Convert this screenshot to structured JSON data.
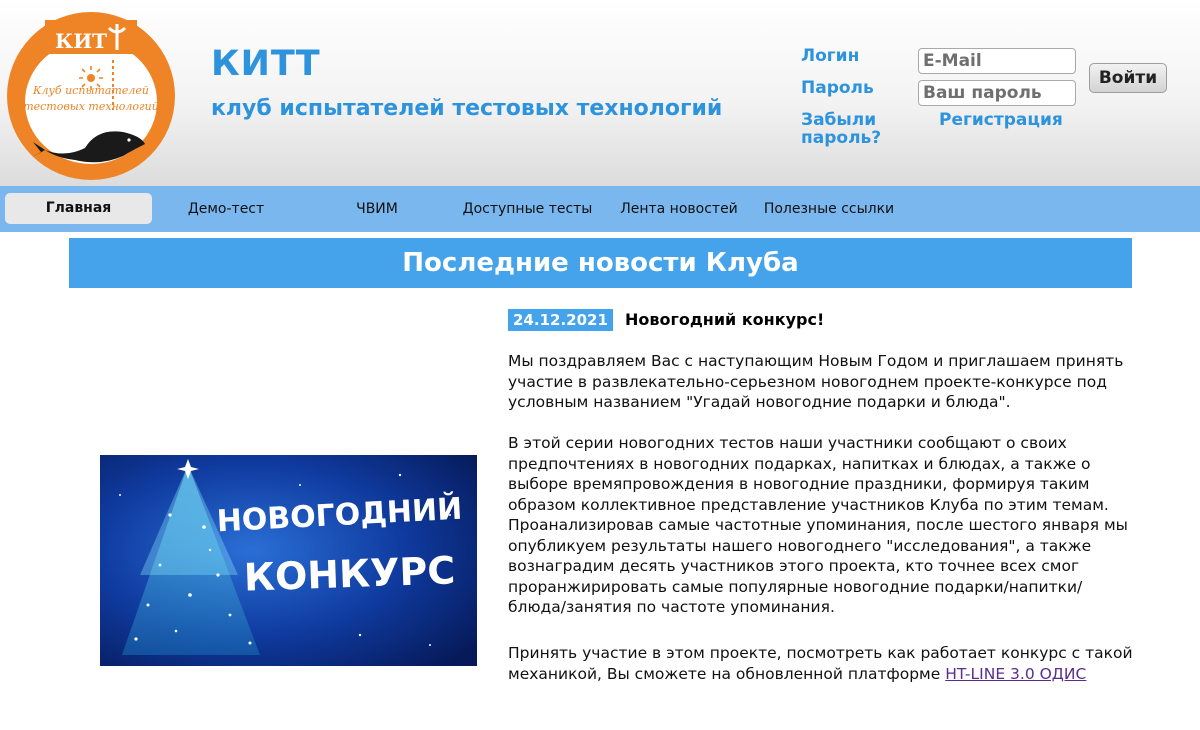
{
  "header": {
    "logo_text_top": "КИТ",
    "logo_text_line1": "Клуб испытателей",
    "logo_text_line2": "тестовых технологий",
    "title": "КИТТ",
    "subtitle": "клуб испытателей тестовых технологий"
  },
  "login": {
    "login_label": "Логин",
    "password_label": "Пароль",
    "email_placeholder": "E-Mail",
    "password_placeholder": "Ваш пароль",
    "submit_label": "Войти",
    "forgot_label": "Забыли пароль?",
    "register_label": "Регистрация"
  },
  "nav": {
    "items": [
      {
        "label": "Главная",
        "active": true
      },
      {
        "label": "Демо-тест"
      },
      {
        "label": "ЧВИМ"
      },
      {
        "label": "Доступные тесты"
      },
      {
        "label": "Лента новостей"
      },
      {
        "label": "Полезные ссылки"
      }
    ]
  },
  "news": {
    "heading": "Последние новости Клуба",
    "image_line1": "НОВОГОДНИЙ",
    "image_line2": "КОНКУРС",
    "date": "24.12.2021",
    "title": "Новогодний конкурс!",
    "paragraph1": "Мы поздравляем Вас с наступающим Новым Годом и приглашаем принять участие в развлекательно-серьезном новогоднем проекте-конкурсе под условным названием \"Угадай новогодние подарки и блюда\".",
    "paragraph2": "В этой серии новогодних тестов наши участники сообщают о своих предпочтениях в новогодних подарках, напитках и блюдах, а также о выборе времяпровождения в новогодние праздники, формируя таким образом коллективное представление участников Клуба по этим темам. Проанализировав самые частотные упоминания, после шестого января мы опубликуем результаты нашего новогоднего \"исследования\", а также вознаградим десять участников этого проекта, кто точнее всех смог проранжирировать самые популярные новогодние подарки/напитки/блюда/занятия по частоте упоминания.",
    "paragraph3_text": "Принять участие в этом проекте, посмотреть как работает конкурс с такой механикой, Вы сможете на обновленной платформе ",
    "paragraph3_link": "HT-LINE 3.0 ОДИС"
  },
  "colors": {
    "brand_blue": "#2d93dc",
    "nav_bg": "#79b7ee",
    "heading_bg": "#45a3eb",
    "logo_orange": "#ef8426",
    "link_visited": "#5a2d8c"
  }
}
